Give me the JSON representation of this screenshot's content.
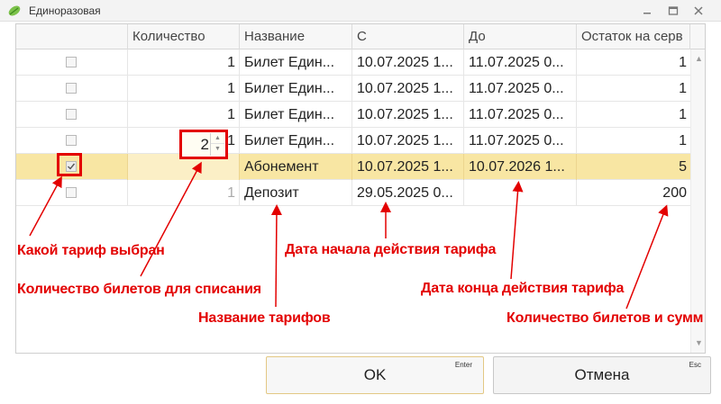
{
  "window": {
    "title": "Единоразовая",
    "app_icon": "leaf-icon",
    "controls": [
      "minimize-icon",
      "maximize-icon",
      "close-icon"
    ]
  },
  "grid": {
    "columns": [
      "",
      "Количество",
      "Название",
      "С",
      "До",
      "Остаток на серв"
    ],
    "rows": [
      {
        "checked": false,
        "qty": "1",
        "name": "Билет Един...",
        "from": "10.07.2025 1...",
        "to": "11.07.2025 0...",
        "remainder": "1"
      },
      {
        "checked": false,
        "qty": "1",
        "name": "Билет Един...",
        "from": "10.07.2025 1...",
        "to": "11.07.2025 0...",
        "remainder": "1"
      },
      {
        "checked": false,
        "qty": "1",
        "name": "Билет Един...",
        "from": "10.07.2025 1...",
        "to": "11.07.2025 0...",
        "remainder": "1"
      },
      {
        "checked": false,
        "qty": "1",
        "name": "Билет Един...",
        "from": "10.07.2025 1...",
        "to": "11.07.2025 0...",
        "remainder": "1"
      },
      {
        "checked": true,
        "qty": "2",
        "name": "Абонемент",
        "from": "10.07.2025 1...",
        "to": "10.07.2026 1...",
        "remainder": "5"
      },
      {
        "checked": false,
        "qty": "1",
        "name": "Депозит",
        "from": "29.05.2025 0...",
        "to": "",
        "remainder": "200"
      }
    ],
    "selected_row_index": 4,
    "spin_up_icon": "chevron-up-icon",
    "spin_down_icon": "chevron-down-icon",
    "scroll_up_icon": "triangle-up-icon",
    "scroll_down_icon": "triangle-down-icon"
  },
  "annotations": {
    "tariff_selected": "Какой тариф выбран",
    "tickets_to_deduct": "Количество билетов для списания",
    "tariff_names": "Название тарифов",
    "start_date": "Дата начала действия тарифа",
    "end_date": "Дата конца действия тарифа",
    "tickets_and_sums": "Количество билетов и сумм"
  },
  "buttons": {
    "ok_label": "OK",
    "ok_hint": "Enter",
    "cancel_label": "Отмена",
    "cancel_hint": "Esc"
  },
  "colors": {
    "annotation_red": "#e30000",
    "selected_row": "#f8e6a3"
  }
}
